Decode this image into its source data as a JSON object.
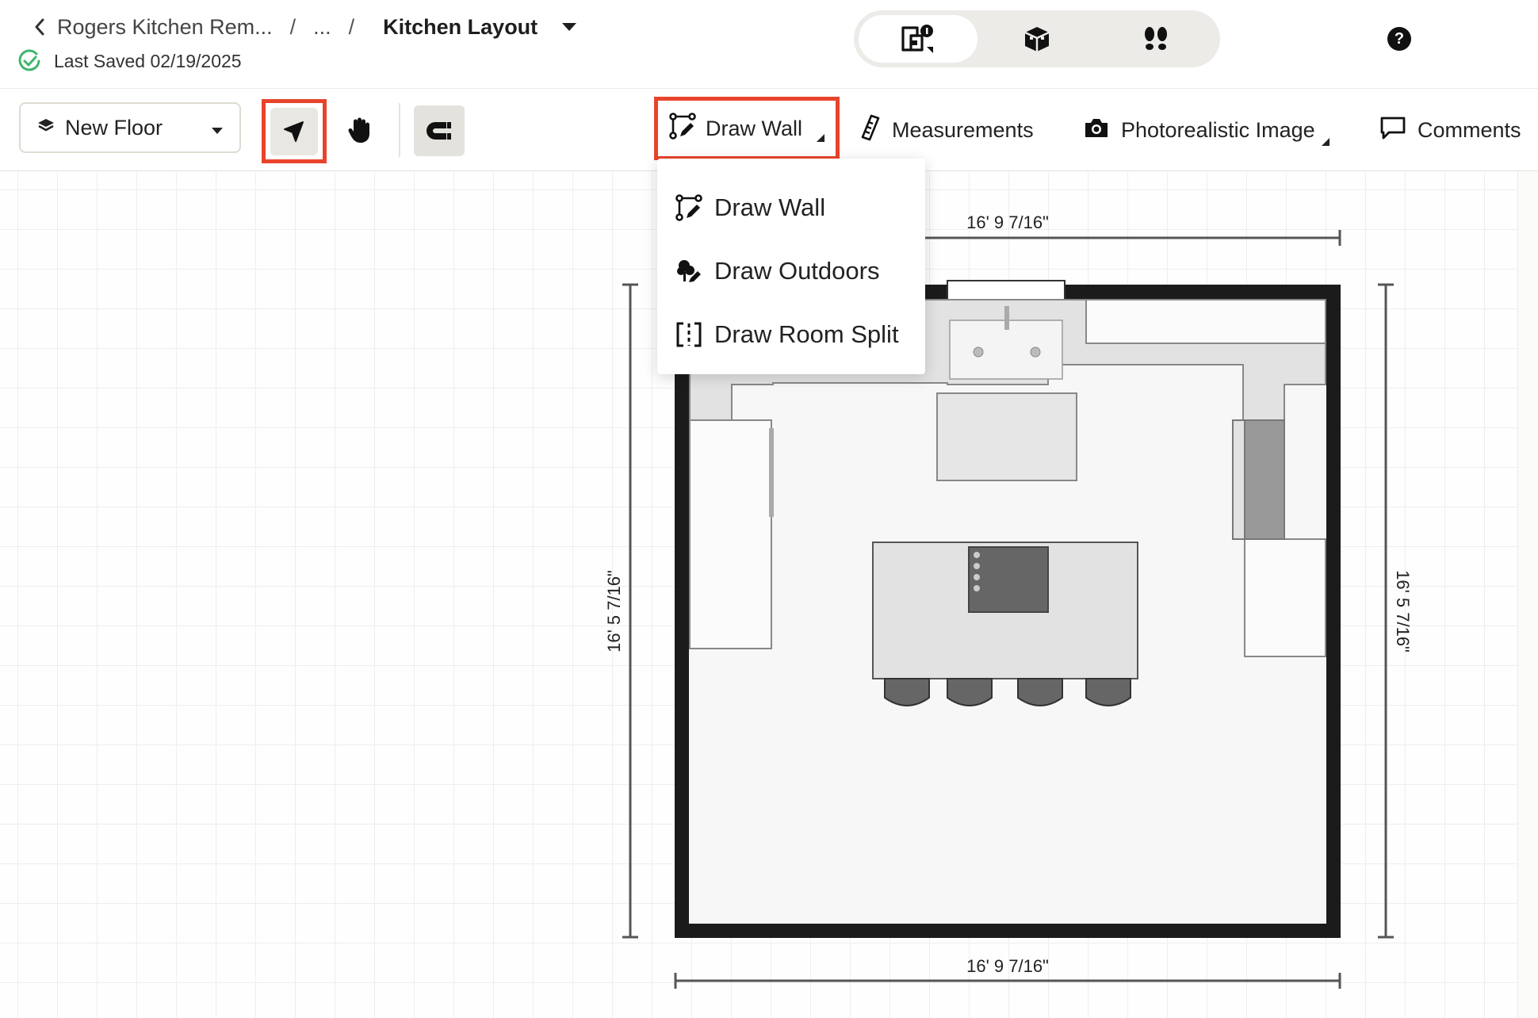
{
  "header": {
    "breadcrumb": {
      "project": "Rogers Kitchen Rem...",
      "ellipsis": "...",
      "separator": "/",
      "current": "Kitchen Layout"
    },
    "last_saved": "Last Saved 02/19/2025",
    "view_toggle": {
      "options": [
        "2d-floorplan-view",
        "3d-view",
        "walkthrough-view"
      ],
      "active": "2d-floorplan-view"
    },
    "help_label": "?"
  },
  "toolbar": {
    "floor_select": "New Floor",
    "draw_wall": "Draw Wall",
    "measurements": "Measurements",
    "photorealistic": "Photorealistic Image",
    "comments": "Comments"
  },
  "draw_menu": {
    "items": [
      {
        "label": "Draw Wall",
        "icon": "draw-wall-icon"
      },
      {
        "label": "Draw Outdoors",
        "icon": "draw-outdoors-icon"
      },
      {
        "label": "Draw Room Split",
        "icon": "room-split-icon"
      }
    ]
  },
  "floorplan": {
    "dim_top": "16' 9 7/16\"",
    "dim_bottom": "16' 9 7/16\"",
    "dim_left": "16' 5 7/16\"",
    "dim_right": "16' 5 7/16\""
  },
  "colors": {
    "highlight": "#e8442c",
    "wall": "#1b1b1b",
    "counter": "#e2e2e2",
    "appliance": "#666666",
    "saved_check": "#3fb56f"
  }
}
